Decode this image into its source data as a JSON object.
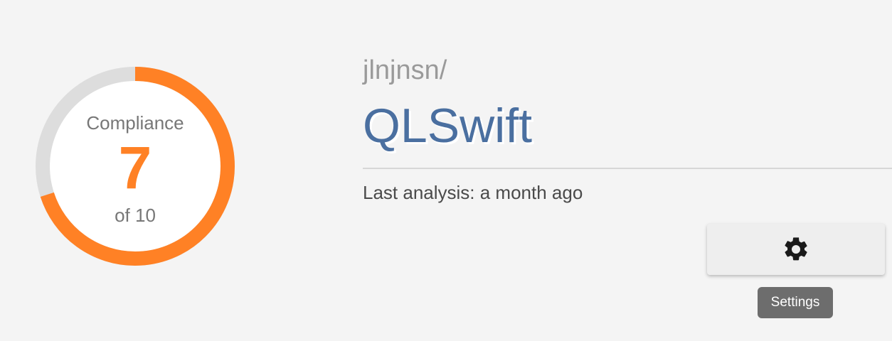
{
  "compliance": {
    "label": "Compliance",
    "value": "7",
    "total_text": "of 10",
    "fraction": 0.7,
    "color": "#ff8125",
    "track_color": "#dddddd"
  },
  "repository": {
    "owner": "jlnjnsn/",
    "name": "QLSwift",
    "last_analysis": "Last analysis: a month ago"
  },
  "actions": {
    "settings_icon": "gear-icon",
    "settings_tooltip": "Settings"
  }
}
